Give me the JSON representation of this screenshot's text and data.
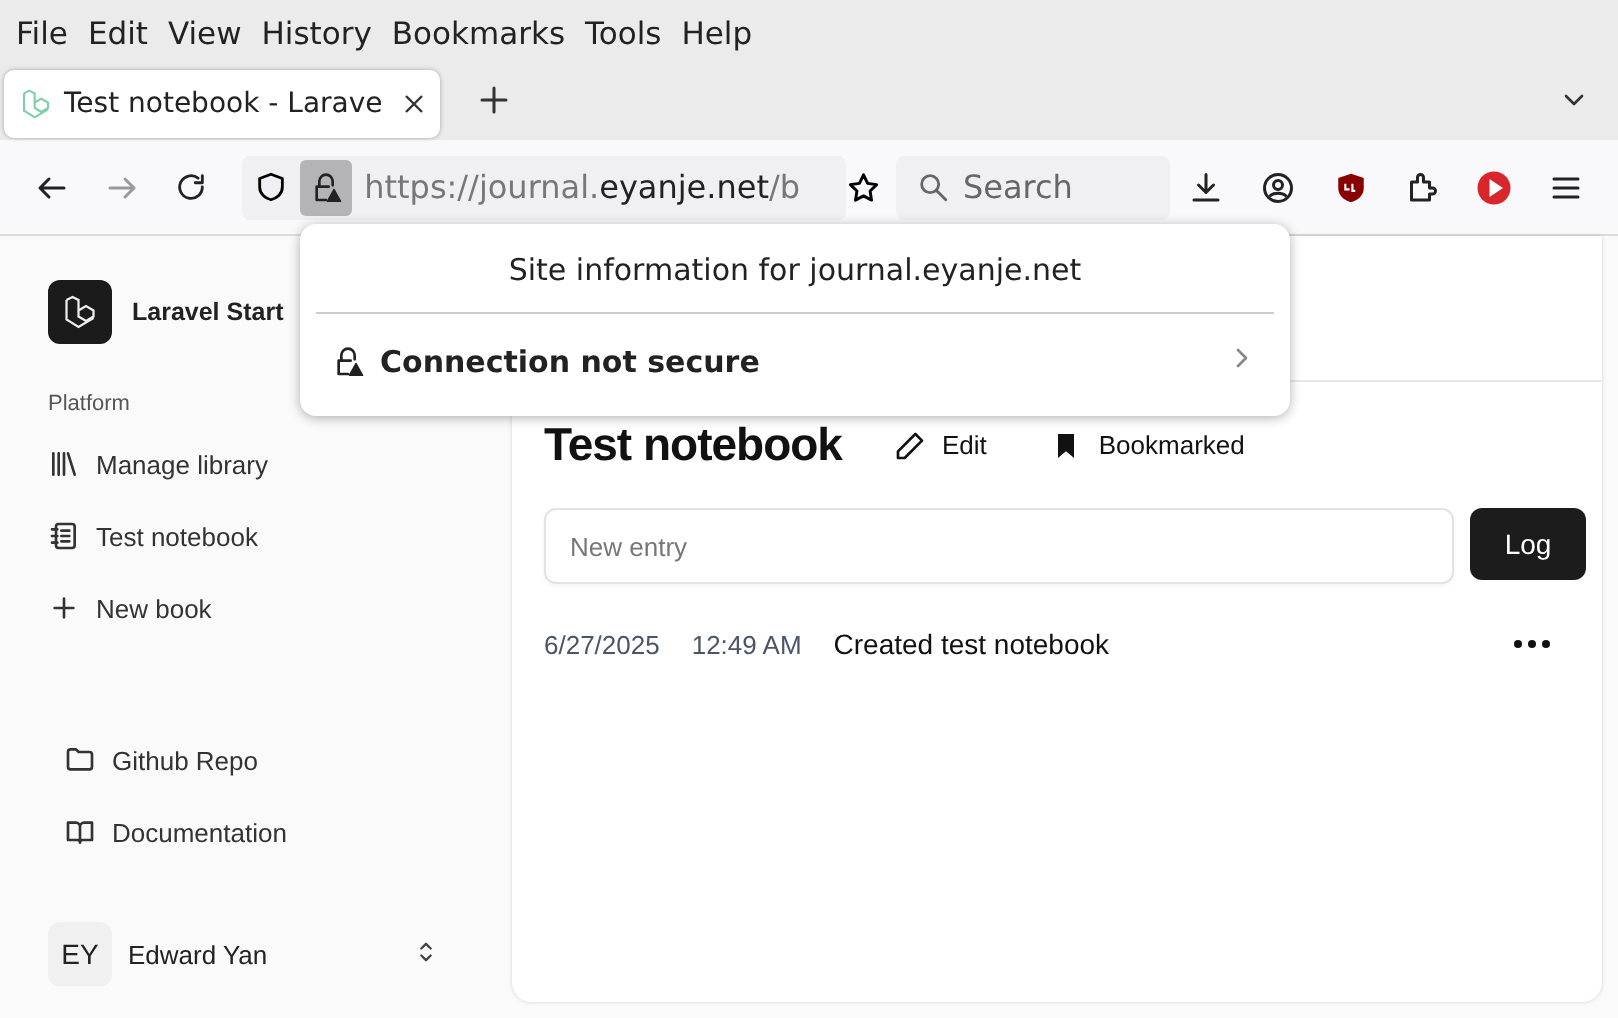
{
  "menu_bar": [
    "File",
    "Edit",
    "View",
    "History",
    "Bookmarks",
    "Tools",
    "Help"
  ],
  "tabs": [
    {
      "title": "Test notebook - Larave",
      "selected": true
    }
  ],
  "address_bar": {
    "url_dim": "https://journal.",
    "url_host": "eyanje.net",
    "url_tail": "/b"
  },
  "search": {
    "placeholder": "Search"
  },
  "site_popup": {
    "title": "Site information for journal.eyanje.net",
    "item": "Connection not secure"
  },
  "sidebar": {
    "app_name": "Laravel Start",
    "section": "Platform",
    "items": [
      {
        "label": "Manage library",
        "kind": "library"
      },
      {
        "label": "Test notebook",
        "kind": "notebook"
      },
      {
        "label": "New book",
        "kind": "add"
      }
    ],
    "footer_links": [
      {
        "label": "Github Repo",
        "kind": "repo"
      },
      {
        "label": "Documentation",
        "kind": "docs"
      }
    ],
    "user": {
      "initials": "EY",
      "name": "Edward Yan"
    }
  },
  "notebook": {
    "title": "Test notebook",
    "edit": "Edit",
    "bookmark": "Bookmarked",
    "entry_placeholder": "New entry",
    "log_button": "Log",
    "entries": [
      {
        "date": "6/27/2025",
        "time": "12:49 AM",
        "text": "Created test notebook"
      }
    ]
  }
}
